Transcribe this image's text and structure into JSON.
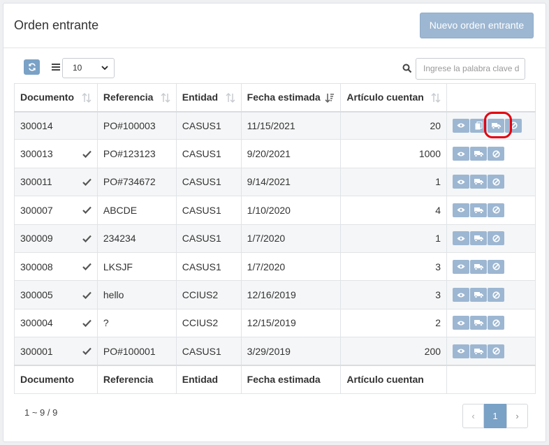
{
  "panel": {
    "title": "Orden entrante",
    "new_button": "Nuevo orden entrante"
  },
  "toolbar": {
    "page_size": "10",
    "search_placeholder": "Ingrese la palabra clave d"
  },
  "columns": [
    "Documento",
    "Referencia",
    "Entidad",
    "Fecha estimada",
    "Artículo cuentan"
  ],
  "rows": [
    {
      "doc": "300014",
      "checked": false,
      "ref": "PO#100003",
      "entity": "CASUS1",
      "date": "11/15/2021",
      "count": "20",
      "actions": [
        "eye-icon",
        "copy-icon",
        "truck-icon",
        "cancel-icon"
      ]
    },
    {
      "doc": "300013",
      "checked": true,
      "ref": "PO#123123",
      "entity": "CASUS1",
      "date": "9/20/2021",
      "count": "1000",
      "actions": [
        "eye-icon",
        "truck-icon",
        "cancel-icon"
      ]
    },
    {
      "doc": "300011",
      "checked": true,
      "ref": "PO#734672",
      "entity": "CASUS1",
      "date": "9/14/2021",
      "count": "1",
      "actions": [
        "eye-icon",
        "truck-icon",
        "cancel-icon"
      ]
    },
    {
      "doc": "300007",
      "checked": true,
      "ref": "ABCDE",
      "entity": "CASUS1",
      "date": "1/10/2020",
      "count": "4",
      "actions": [
        "eye-icon",
        "truck-icon",
        "cancel-icon"
      ]
    },
    {
      "doc": "300009",
      "checked": true,
      "ref": "234234",
      "entity": "CASUS1",
      "date": "1/7/2020",
      "count": "1",
      "actions": [
        "eye-icon",
        "truck-icon",
        "cancel-icon"
      ]
    },
    {
      "doc": "300008",
      "checked": true,
      "ref": "LKSJF",
      "entity": "CASUS1",
      "date": "1/7/2020",
      "count": "3",
      "actions": [
        "eye-icon",
        "truck-icon",
        "cancel-icon"
      ]
    },
    {
      "doc": "300005",
      "checked": true,
      "ref": "hello",
      "entity": "CCIUS2",
      "date": "12/16/2019",
      "count": "3",
      "actions": [
        "eye-icon",
        "truck-icon",
        "cancel-icon"
      ]
    },
    {
      "doc": "300004",
      "checked": true,
      "ref": "?",
      "entity": "CCIUS2",
      "date": "12/15/2019",
      "count": "2",
      "actions": [
        "eye-icon",
        "truck-icon",
        "cancel-icon"
      ]
    },
    {
      "doc": "300001",
      "checked": true,
      "ref": "PO#100001",
      "entity": "CASUS1",
      "date": "3/29/2019",
      "count": "200",
      "actions": [
        "eye-icon",
        "truck-icon",
        "cancel-icon"
      ]
    }
  ],
  "footer": {
    "summary": "1 ~ 9 / 9",
    "prev": "‹",
    "current_page": "1",
    "next": "›"
  },
  "colors": {
    "accent": "#7aa1c6",
    "button": "#9db7d2",
    "highlight": "#e3000f"
  }
}
